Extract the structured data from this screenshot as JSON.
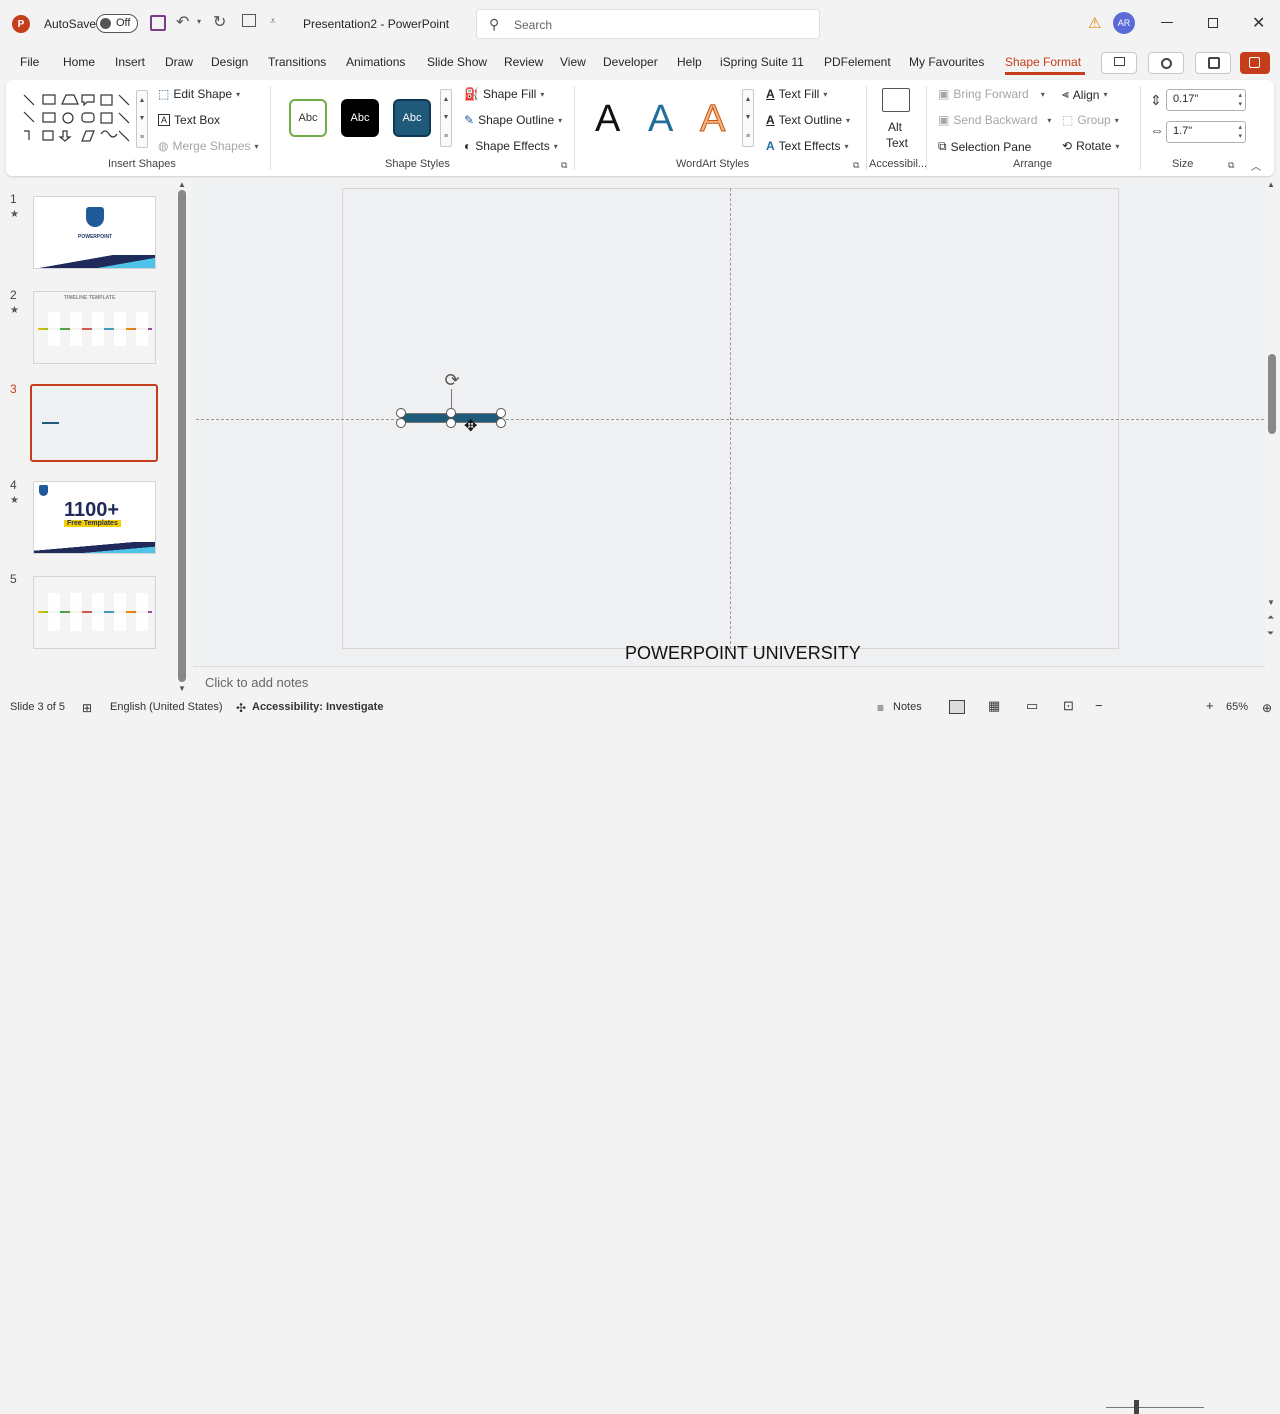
{
  "titlebar": {
    "autosave_label": "AutoSave",
    "autosave_state": "Off",
    "document_title": "Presentation2 - PowerPoint",
    "search_placeholder": "Search",
    "user_initials": "AR"
  },
  "menu_tabs": [
    "File",
    "Home",
    "Insert",
    "Draw",
    "Design",
    "Transitions",
    "Animations",
    "Slide Show",
    "Review",
    "View",
    "Developer",
    "Help",
    "iSpring Suite 11",
    "PDFelement",
    "My Favourites",
    "Shape Format"
  ],
  "active_tab": "Shape Format",
  "ribbon": {
    "insert_shapes": {
      "edit_shape": "Edit Shape",
      "text_box": "Text Box",
      "merge_shapes": "Merge Shapes",
      "label": "Insert Shapes"
    },
    "shape_styles": {
      "preset_label": "Abc",
      "shape_fill": "Shape Fill",
      "shape_outline": "Shape Outline",
      "shape_effects": "Shape Effects",
      "label": "Shape Styles"
    },
    "wordart_styles": {
      "sample": "A",
      "text_fill": "Text Fill",
      "text_outline": "Text Outline",
      "text_effects": "Text Effects",
      "label": "WordArt Styles"
    },
    "accessibility": {
      "alt_text_line1": "Alt",
      "alt_text_line2": "Text",
      "label": "Accessibil..."
    },
    "arrange": {
      "bring_forward": "Bring Forward",
      "send_backward": "Send Backward",
      "selection_pane": "Selection Pane",
      "align": "Align",
      "group": "Group",
      "rotate": "Rotate",
      "label": "Arrange"
    },
    "size": {
      "height": "0.17\"",
      "width": "1.7\"",
      "label": "Size"
    }
  },
  "slides": [
    {
      "num": "1",
      "star": "★",
      "title": "POWERPOINT"
    },
    {
      "num": "2",
      "star": "★",
      "title": "TIMELINE TEMPLATE"
    },
    {
      "num": "3",
      "star": ""
    },
    {
      "num": "4",
      "star": "★",
      "title": "1100+",
      "subtitle": "Free Templates"
    },
    {
      "num": "5",
      "star": ""
    }
  ],
  "current_slide_index": 3,
  "slide": {
    "watermark": "POWERPOINT UNIVERSITY",
    "shape_color": "#1f5a7a"
  },
  "notes_placeholder": "Click to add notes",
  "status": {
    "slide_info": "Slide 3 of 5",
    "language": "English (United States)",
    "accessibility": "Accessibility: Investigate",
    "notes": "Notes",
    "zoom": "65%"
  },
  "colors": {
    "accent": "#c43e1c",
    "active_thumb_border": "#c43e1c",
    "style_teal": "#1f5a7a",
    "style_green": "#70ad47"
  }
}
